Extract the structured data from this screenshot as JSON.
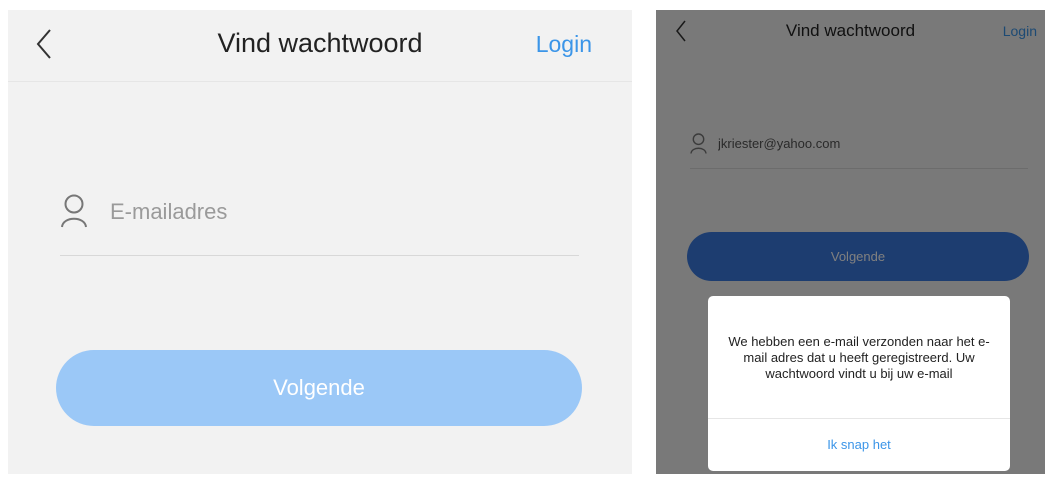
{
  "left_screen": {
    "header": {
      "title": "Vind wachtwoord",
      "login_label": "Login"
    },
    "email_field": {
      "placeholder": "E-mailadres",
      "value": ""
    },
    "next_button_label": "Volgende",
    "icons": [
      "back-chevron-icon",
      "user-icon"
    ]
  },
  "right_screen": {
    "header": {
      "title": "Vind wachtwoord",
      "login_label": "Login"
    },
    "email_field": {
      "placeholder": "E-mailadres",
      "value": "jkriester@yahoo.com"
    },
    "next_button_label": "Volgende",
    "dialog": {
      "message": "We hebben een e-mail verzonden naar het e-mail adres dat u heeft geregistreerd. Uw wachtwoord vindt u bij uw e-mail",
      "button_label": "Ik snap het"
    },
    "icons": [
      "back-chevron-icon",
      "user-icon"
    ]
  },
  "colors": {
    "accent_blue": "#3b95e8",
    "button_disabled": "#9bc8f7",
    "button_active": "#3b7ae0",
    "background": "#f2f2f2"
  }
}
